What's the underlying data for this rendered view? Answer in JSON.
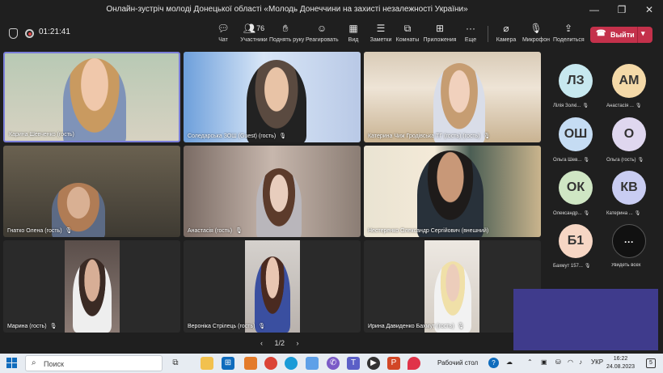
{
  "window": {
    "title": "Онлайн-зустріч молоді Донецької області «Молодь Донеччини на захисті незалежності України»",
    "minimize": "—",
    "maximize": "❐",
    "close": "✕"
  },
  "toolbar": {
    "timer": "01:21:41",
    "items": [
      {
        "label": "Чат",
        "icon": "chat-icon"
      },
      {
        "label": "Участники",
        "icon": "people-icon",
        "count": "76"
      },
      {
        "label": "Поднять руку",
        "icon": "raise-hand-icon"
      },
      {
        "label": "Реагировать",
        "icon": "react-icon"
      },
      {
        "label": "Вид",
        "icon": "view-icon"
      },
      {
        "label": "Заметки",
        "icon": "notes-icon"
      },
      {
        "label": "Комнаты",
        "icon": "rooms-icon"
      },
      {
        "label": "Приложения",
        "icon": "apps-icon"
      },
      {
        "label": "Еще",
        "icon": "more-icon"
      },
      {
        "label": "Камера",
        "icon": "camera-off-icon"
      },
      {
        "label": "Микрофон",
        "icon": "mic-off-icon"
      },
      {
        "label": "Поделиться",
        "icon": "share-icon"
      }
    ],
    "leave_label": "Выйти"
  },
  "tiles": [
    {
      "name": "Карина Шевченко (гость)",
      "muted": false,
      "active": true
    },
    {
      "name": "Соледарська ЗОШ (Guest) (гость)",
      "muted": true,
      "active": false
    },
    {
      "name": "Катерина Чиж Гродівська ТГ (гость) (гость)",
      "muted": true,
      "active": false
    },
    {
      "name": "Гнатко Олена (гость)",
      "muted": true,
      "active": false
    },
    {
      "name": "Анастасія (гость)",
      "muted": true,
      "active": false
    },
    {
      "name": "Нестеренко Олександр Сергійович (внешний)",
      "muted": false,
      "active": false
    },
    {
      "name": "Марина (гость)",
      "muted": true,
      "active": false
    },
    {
      "name": "Вероніка Стрілець (гость)",
      "muted": true,
      "active": false
    },
    {
      "name": "Ирина Давиденко Бахмут (гость)",
      "muted": true,
      "active": false
    }
  ],
  "roster": [
    {
      "initials": "ЛЗ",
      "name": "Лілія Золкі...",
      "color": "#c7e8ef"
    },
    {
      "initials": "АМ",
      "name": "Анастасія ...",
      "color": "#f4d9a8"
    },
    {
      "initials": "ОШ",
      "name": "Ольга Шев...",
      "color": "#c5dcf3"
    },
    {
      "initials": "О",
      "name": "Ольга (гость)",
      "color": "#dfd7ef"
    },
    {
      "initials": "ОК",
      "name": "Олександр...",
      "color": "#cfe6c4"
    },
    {
      "initials": "КВ",
      "name": "Катерина ...",
      "color": "#c9cdf2"
    },
    {
      "initials": "Б1",
      "name": "Бахмут 157...",
      "color": "#f6d6c4"
    },
    {
      "initials": "···",
      "name": "Увидеть всех",
      "color": "#111111"
    }
  ],
  "pager": {
    "prev": "‹",
    "text": "1/2",
    "next": "›"
  },
  "taskbar": {
    "search_placeholder": "Поиск",
    "desktop_label": "Рабочий стол",
    "lang": "УКР",
    "time": "16:22",
    "date": "24.08.2023",
    "notifications": "5"
  }
}
